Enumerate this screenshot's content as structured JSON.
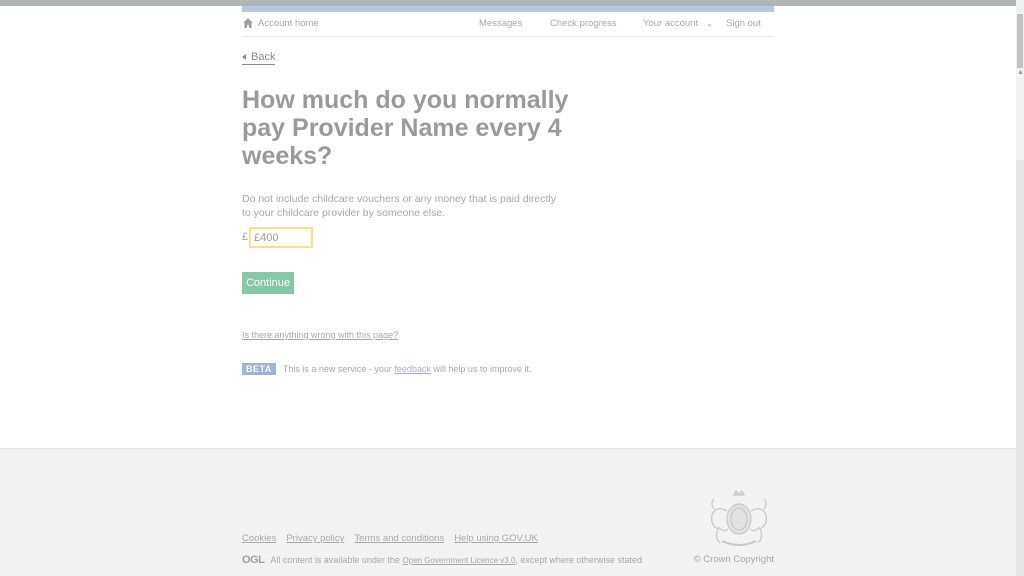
{
  "nav": {
    "home": "Account home",
    "messages": "Messages",
    "check_progress": "Check progress",
    "your_account": "Your account",
    "sign_out": "Sign out"
  },
  "back": "Back",
  "title": "How much do you normally pay Provider Name every 4 weeks?",
  "hint": "Do not include childcare vouchers or any money that is paid directly to your childcare provider by someone else.",
  "form": {
    "currency": "£",
    "amount_value": "£400"
  },
  "continue": "Continue",
  "report_link": "Is there anything wrong with this page?",
  "beta": {
    "tag": "BETA",
    "text_before": "This is a new service - your ",
    "feedback_link": "feedback",
    "text_after": " will help us to improve it."
  },
  "footer": {
    "links": [
      "Cookies",
      "Privacy policy",
      "Terms and conditions",
      "Help using GOV.UK"
    ],
    "ogl_logo": "OGL",
    "licence_before": "All content is available under the ",
    "licence_link": "Open Government Licence v3.0",
    "licence_after": ", except where otherwise stated",
    "copyright": "© Crown Copyright"
  },
  "icons": {
    "home": "home-icon",
    "chevron": "chevron-down-icon",
    "back": "back-arrow-icon",
    "crest": "royal-crest-icon"
  },
  "colors": {
    "continue_bg": "#85c7a6",
    "focus_border": "#ffdd8a",
    "beta_tag": "#9cb2d6"
  }
}
